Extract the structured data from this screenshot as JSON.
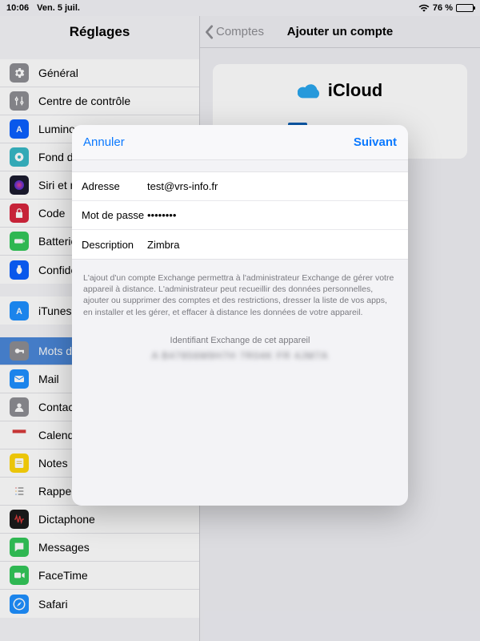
{
  "status": {
    "time": "10:06",
    "date": "Ven. 5 juil.",
    "battery_pct": "76 %"
  },
  "sidebar": {
    "title": "Réglages",
    "groups": [
      {
        "items": [
          {
            "key": "general",
            "label": "Général",
            "bg": "#8e8e93"
          },
          {
            "key": "control",
            "label": "Centre de contrôle",
            "bg": "#8e8e93"
          },
          {
            "key": "display",
            "label": "Luminosité et affichage",
            "bg": "#0a60ff"
          },
          {
            "key": "wallpaper",
            "label": "Fond d'écran",
            "bg": "#38b8c6"
          },
          {
            "key": "siri",
            "label": "Siri et recherche",
            "bg": "#1b1b2e"
          },
          {
            "key": "code",
            "label": "Code",
            "bg": "#d7263d"
          },
          {
            "key": "battery",
            "label": "Batterie",
            "bg": "#34c759"
          },
          {
            "key": "privacy",
            "label": "Confidentialité",
            "bg": "#0a60ff"
          }
        ]
      },
      {
        "items": [
          {
            "key": "itunes",
            "label": "iTunes Store et App Store",
            "bg": "#1e90ff"
          }
        ]
      },
      {
        "items": [
          {
            "key": "passwords",
            "label": "Mots de passe et comptes",
            "bg": "#8e8e93",
            "selected": true
          },
          {
            "key": "mail",
            "label": "Mail",
            "bg": "#1e90ff"
          },
          {
            "key": "contacts",
            "label": "Contacts",
            "bg": "#8e8e93"
          },
          {
            "key": "calendar",
            "label": "Calendrier",
            "bg": "#ffffff"
          },
          {
            "key": "notes",
            "label": "Notes",
            "bg": "#ffd60a"
          },
          {
            "key": "reminders",
            "label": "Rappels",
            "bg": "#ffffff"
          },
          {
            "key": "voice",
            "label": "Dictaphone",
            "bg": "#1b1b1b"
          },
          {
            "key": "messages",
            "label": "Messages",
            "bg": "#34c759"
          },
          {
            "key": "facetime",
            "label": "FaceTime",
            "bg": "#34c759"
          },
          {
            "key": "safari",
            "label": "Safari",
            "bg": "#1e90ff"
          }
        ]
      }
    ]
  },
  "detail": {
    "back_label": "Comptes",
    "title": "Ajouter un compte",
    "providers": {
      "icloud": "iCloud",
      "exchange": "Exchange"
    }
  },
  "sheet": {
    "cancel": "Annuler",
    "next": "Suivant",
    "fields": {
      "address_label": "Adresse",
      "address_value": "test@vrs-info.fr",
      "password_label": "Mot de passe",
      "password_value": "••••••••",
      "desc_label": "Description",
      "desc_value": "Zimbra"
    },
    "info": "L'ajout d'un compte Exchange permettra à l'administrateur Exchange de gérer votre appareil à distance. L'administrateur peut recueillir des données personnelles, ajouter ou supprimer des comptes et des restrictions, dresser la liste de vos apps, en installer et les gérer, et effacer à distance les données de votre appareil.",
    "device_id_label": "Identifiant Exchange de cet appareil",
    "device_id_value": "A B47856M9H7H 7R04K FR 4JM7A"
  },
  "icons": {
    "general": "<svg width='16' height='16' viewBox='0 0 24 24' fill='white'><path d='M19.4 13a7.5 7.5 0 000-2l2-1.6-2-3.4-2.4.9a7.5 7.5 0 00-1.7-1L15 3h-4l-.3 2.9a7.5 7.5 0 00-1.7 1l-2.4-.9-2 3.4 2 1.6a7.5 7.5 0 000 2l-2 1.6 2 3.4 2.4-.9a7.5 7.5 0 001.7 1L11 21h4l.3-2.9a7.5 7.5 0 001.7-1l2.4.9 2-3.4zM12 15a3 3 0 110-6 3 3 0 010 6z'/></svg>",
    "control": "<svg width='16' height='16' viewBox='0 0 24 24' fill='none' stroke='white' stroke-width='2'><circle cx='7' cy='9' r='2'/><circle cx='17' cy='15' r='2'/><path d='M7 4v3M7 11v9M17 4v9M17 17v3'/></svg>",
    "display": "<svg width='16' height='16' viewBox='0 0 24 24' fill='white'><text x='12' y='18' font-size='16' font-weight='bold' text-anchor='middle'>A</text></svg>",
    "wallpaper": "<svg width='16' height='16' viewBox='0 0 24 24' fill='white'><circle cx='12' cy='12' r='8'/><circle cx='12' cy='12' r='3' fill='#38b8c6'/></svg>",
    "siri": "<svg width='16' height='16' viewBox='0 0 24 24'><circle cx='12' cy='12' r='9' fill='url(#g)'/><defs><radialGradient id='g'><stop offset='0' stop-color='#e83e8c'/><stop offset='1' stop-color='#4b2fd6'/></radialGradient></defs></svg>",
    "code": "<svg width='14' height='14' viewBox='0 0 24 24' fill='white'><path d='M17 10V7a5 5 0 00-10 0v3H5v12h14V10zm-8-3a3 3 0 016 0v3H9z'/></svg>",
    "battery": "<svg width='16' height='16' viewBox='0 0 24 24' fill='white'><rect x='3' y='8' width='16' height='8' rx='2'/><rect x='20' y='10' width='2' height='4'/></svg>",
    "privacy": "<svg width='14' height='14' viewBox='0 0 24 24' fill='white'><path d='M9 2h6v4a9 9 0 01-3 15A9 9 0 019 6z'/></svg>",
    "itunes": "<svg width='16' height='16' viewBox='0 0 24 24' fill='white'><text x='12' y='18' font-size='16' font-weight='bold' text-anchor='middle'>A</text></svg>",
    "passwords": "<svg width='14' height='14' viewBox='0 0 24 24' fill='white'><circle cx='8' cy='12' r='5'/><rect x='12' y='10' width='10' height='4'/><rect x='19' y='10' width='3' height='7'/></svg>",
    "mail": "<svg width='16' height='16' viewBox='0 0 24 24' fill='white'><rect x='3' y='6' width='18' height='12' rx='2'/><path d='M3 7l9 6 9-6' stroke='#1e90ff' stroke-width='1.5' fill='none'/></svg>",
    "contacts": "<svg width='16' height='16' viewBox='0 0 24 24' fill='white'><circle cx='12' cy='9' r='4'/><path d='M4 21a8 8 0 0116 0z'/></svg>",
    "calendar": "<svg width='20' height='20' viewBox='0 0 24 24'><rect x='2' y='4' width='20' height='5' fill='#d73a3a'/><rect x='2' y='9' width='20' height='12' fill='#fff'/></svg>",
    "notes": "<svg width='16' height='16' viewBox='0 0 24 24' fill='white'><rect x='4' y='3' width='16' height='18' rx='2'/><line x1='7' y1='9' x2='17' y2='9' stroke='#c9a400'/><line x1='7' y1='13' x2='17' y2='13' stroke='#c9a400'/></svg>",
    "reminders": "<svg width='16' height='16' viewBox='0 0 24 24' fill='none' stroke='#888' stroke-width='2'><circle cx='6' cy='6' r='1' fill='#d73a3a' stroke='none'/><circle cx='6' cy='12' r='1' fill='#f0a020' stroke='none'/><circle cx='6' cy='18' r='1' fill='#4a87d8' stroke='none'/><line x1='10' y1='6' x2='20' y2='6'/><line x1='10' y1='12' x2='20' y2='12'/><line x1='10' y1='18' x2='20' y2='18'/></svg>",
    "voice": "<svg width='16' height='16' viewBox='0 0 24 24' fill='none' stroke='#d73a3a' stroke-width='2'><path d='M3 12h2l2-6 3 12 3-12 3 12 2-6h3'/></svg>",
    "messages": "<svg width='16' height='16' viewBox='0 0 24 24' fill='white'><path d='M4 4h16v12H9l-5 4z'/></svg>",
    "facetime": "<svg width='16' height='16' viewBox='0 0 24 24' fill='white'><rect x='3' y='7' width='12' height='10' rx='2'/><path d='M17 10l5-3v10l-5-3z'/></svg>",
    "safari": "<svg width='18' height='18' viewBox='0 0 24 24'><circle cx='12' cy='12' r='10' fill='#fff'/><circle cx='12' cy='12' r='8' fill='#1e90ff'/><path d='M8 16l3-5 5-3-3 5z' fill='#fff'/></svg>"
  }
}
